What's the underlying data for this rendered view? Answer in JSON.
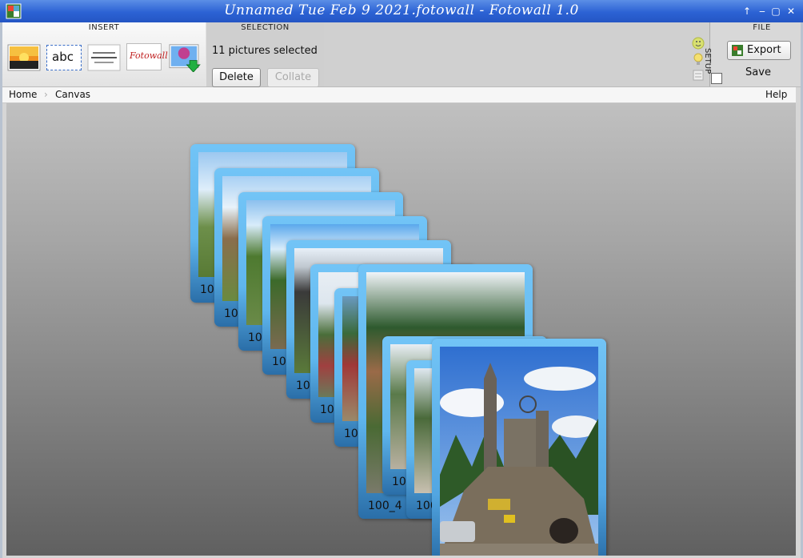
{
  "window": {
    "title": "Unnamed Tue Feb 9 2021.fotowall - Fotowall 1.0",
    "controls": [
      "↑",
      "‒",
      "▢",
      "✕"
    ]
  },
  "toolbar": {
    "insert_label": "INSERT",
    "selection_label": "SELECTION",
    "setup_label": "SETUP",
    "file_label": "FILE",
    "tools": [
      {
        "name": "add-picture-tool",
        "icon": "sunset-picture-icon"
      },
      {
        "name": "add-text-tool",
        "text": "abc"
      },
      {
        "name": "add-wordcloud-tool",
        "icon": "wordcloud-icon"
      },
      {
        "name": "add-webcam-tool",
        "text": "Fotowall"
      },
      {
        "name": "download-picture-tool",
        "icon": "balloon-download-icon"
      }
    ],
    "selection_status": "11 pictures selected",
    "delete_label": "Delete",
    "collate_label": "Collate",
    "export_label": "Export",
    "save_label": "Save"
  },
  "breadcrumb": {
    "home": "Home",
    "separator": "›",
    "current": "Canvas",
    "help": "Help"
  },
  "canvas": {
    "captions": [
      "100",
      "100",
      "100",
      "100",
      "100",
      "100",
      "100",
      "100",
      "100_4",
      "100"
    ]
  }
}
